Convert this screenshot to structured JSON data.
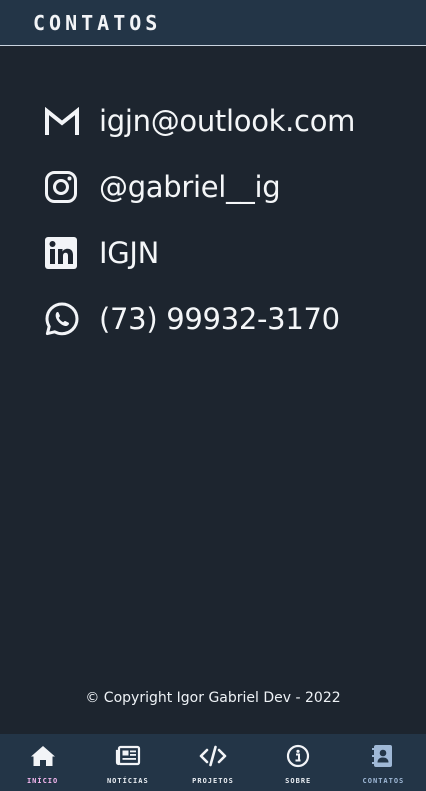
{
  "header": {
    "title": "CONTATOS"
  },
  "contacts": [
    {
      "icon": "gmail-icon",
      "text": "igjn@outlook.com"
    },
    {
      "icon": "instagram-icon",
      "text": "@gabriel__ig"
    },
    {
      "icon": "linkedin-icon",
      "text": "IGJN"
    },
    {
      "icon": "whatsapp-icon",
      "text": "(73) 99932-3170"
    }
  ],
  "footer": {
    "copyright": "© Copyright Igor Gabriel Dev - 2022"
  },
  "nav": {
    "items": [
      {
        "icon": "home-icon",
        "label": "INÍCIO"
      },
      {
        "icon": "newspaper-icon",
        "label": "NOTÍCIAS"
      },
      {
        "icon": "code-icon",
        "label": "PROJETOS"
      },
      {
        "icon": "info-icon",
        "label": "SOBRE"
      },
      {
        "icon": "contacts-book-icon",
        "label": "CONTATOS",
        "active": true
      }
    ]
  },
  "colors": {
    "background": "#1d252f",
    "header": "#233547",
    "text": "#f4f6f8",
    "active_nav": "#9fb8d6",
    "home_label": "#f3b7ef"
  }
}
